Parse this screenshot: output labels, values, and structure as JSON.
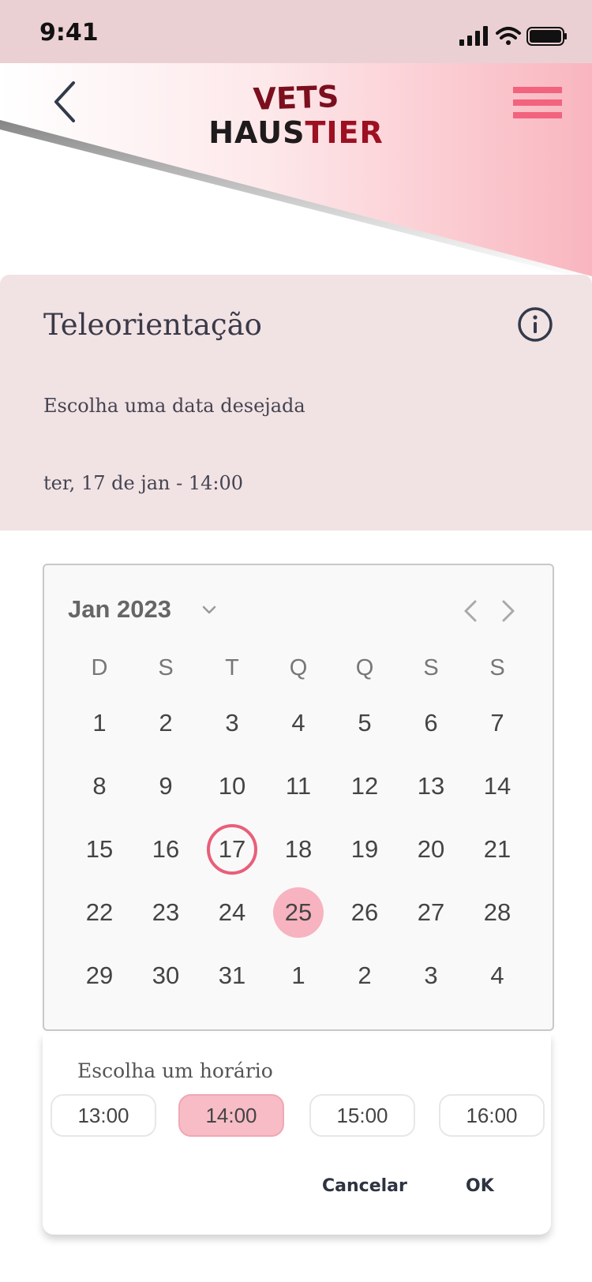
{
  "status_bar": {
    "time": "9:41"
  },
  "header": {
    "logo_line1": "VETS",
    "logo_line2_a": "HAUS",
    "logo_line2_b": "TIER",
    "accent_color": "#f2637e"
  },
  "info": {
    "title": "Teleorientação",
    "subtitle": "Escolha uma data desejada",
    "selected": "ter, 17 de jan  -  14:00"
  },
  "calendar": {
    "month_label": "Jan 2023",
    "weekdays": [
      "D",
      "S",
      "T",
      "Q",
      "Q",
      "S",
      "S"
    ],
    "weeks": [
      [
        "1",
        "2",
        "3",
        "4",
        "5",
        "6",
        "7"
      ],
      [
        "8",
        "9",
        "10",
        "11",
        "12",
        "13",
        "14"
      ],
      [
        "15",
        "16",
        "17",
        "18",
        "19",
        "20",
        "21"
      ],
      [
        "22",
        "23",
        "24",
        "25",
        "26",
        "27",
        "28"
      ],
      [
        "29",
        "30",
        "31",
        "1",
        "2",
        "3",
        "4"
      ]
    ],
    "today": "17",
    "selected_day": "25"
  },
  "time_picker": {
    "label": "Escolha um horário",
    "slots": [
      "13:00",
      "14:00",
      "15:00",
      "16:00"
    ],
    "selected_slot": "14:00",
    "cancel_label": "Cancelar",
    "ok_label": "OK"
  }
}
